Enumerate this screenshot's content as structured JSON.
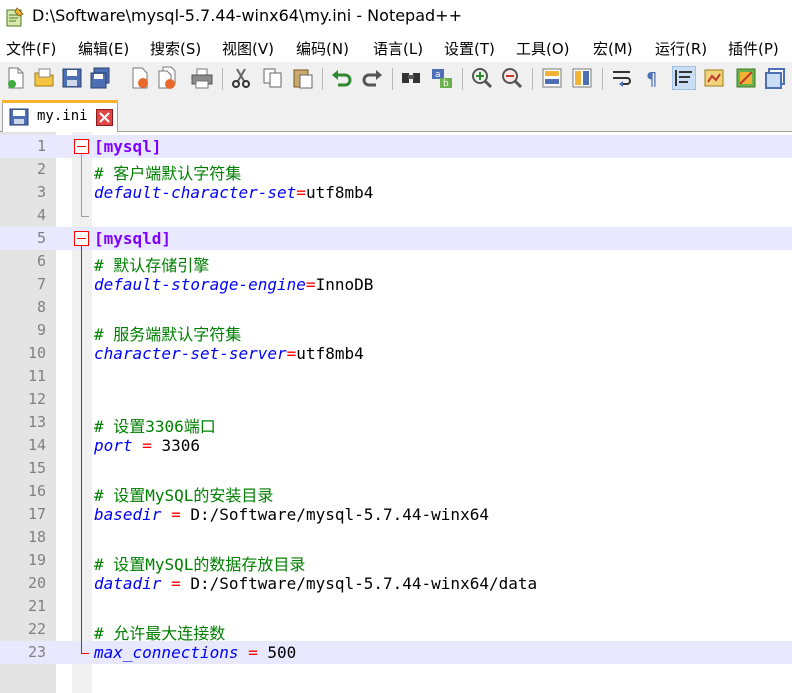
{
  "window": {
    "title": "D:\\Software\\mysql-5.7.44-winx64\\my.ini - Notepad++",
    "app_icon": "notepadpp-icon"
  },
  "menu": [
    {
      "label": "文件(F)"
    },
    {
      "label": "编辑(E)"
    },
    {
      "label": "搜索(S)"
    },
    {
      "label": "视图(V)"
    },
    {
      "label": "编码(N)"
    },
    {
      "label": "语言(L)"
    },
    {
      "label": "设置(T)"
    },
    {
      "label": "工具(O)"
    },
    {
      "label": "宏(M)"
    },
    {
      "label": "运行(R)"
    },
    {
      "label": "插件(P)"
    }
  ],
  "toolbar": {
    "buttons": [
      "new-file-icon",
      "open-file-icon",
      "save-icon",
      "save-all-icon",
      "close-icon",
      "close-all-icon",
      "print-icon",
      "cut-icon",
      "copy-icon",
      "paste-icon",
      "undo-icon",
      "redo-icon",
      "find-icon",
      "replace-icon",
      "zoom-in-icon",
      "zoom-out-icon",
      "sync-vertical-icon",
      "sync-horizontal-icon",
      "word-wrap-icon",
      "show-all-chars-icon",
      "indent-guide-icon",
      "doc-map-icon",
      "function-list-icon",
      "folder-workspace-icon"
    ]
  },
  "tab": {
    "label": "my.ini",
    "icon": "saved-file-icon",
    "close_icon": "tab-close-icon"
  },
  "editor": {
    "lines": [
      {
        "n": "1",
        "section": "[mysql]"
      },
      {
        "n": "2",
        "comment": "# 客户端默认字符集"
      },
      {
        "n": "3",
        "key": "default-character-set",
        "eq": "=",
        "value": "utf8mb4"
      },
      {
        "n": "4"
      },
      {
        "n": "5",
        "section": "[mysqld]"
      },
      {
        "n": "6",
        "comment": "# 默认存储引擎"
      },
      {
        "n": "7",
        "key": "default-storage-engine",
        "eq": "=",
        "value": "InnoDB"
      },
      {
        "n": "8"
      },
      {
        "n": "9",
        "comment": "# 服务端默认字符集"
      },
      {
        "n": "10",
        "key": "character-set-server",
        "eq": "=",
        "value": "utf8mb4"
      },
      {
        "n": "11"
      },
      {
        "n": "12"
      },
      {
        "n": "13",
        "comment": "# 设置3306端口"
      },
      {
        "n": "14",
        "key": "port",
        "eq": " = ",
        "value": "3306"
      },
      {
        "n": "15"
      },
      {
        "n": "16",
        "comment": "# 设置MySQL的安装目录"
      },
      {
        "n": "17",
        "key": "basedir",
        "eq": " = ",
        "value": "D:/Software/mysql-5.7.44-winx64"
      },
      {
        "n": "18"
      },
      {
        "n": "19",
        "comment": "# 设置MySQL的数据存放目录"
      },
      {
        "n": "20",
        "key": "datadir",
        "eq": " = ",
        "value": "D:/Software/mysql-5.7.44-winx64/data"
      },
      {
        "n": "21"
      },
      {
        "n": "22",
        "comment": "# 允许最大连接数"
      },
      {
        "n": "23",
        "key": "max_connections",
        "eq": " = ",
        "value": "500"
      }
    ]
  }
}
